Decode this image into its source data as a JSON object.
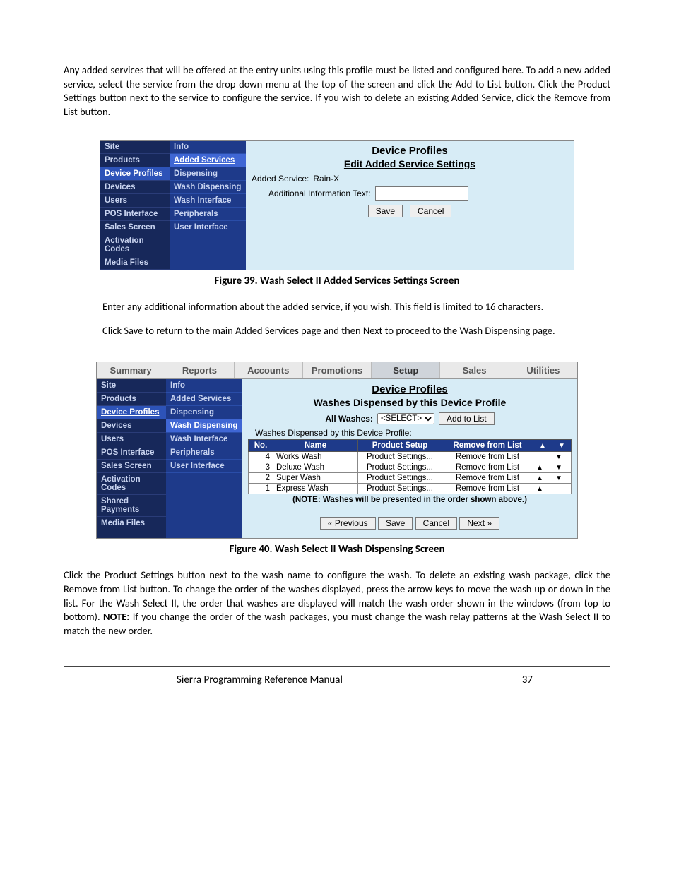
{
  "doc": {
    "para1": "Any added services that will be offered at the entry units using this profile must be listed and configured here. To add a new added service, select the service from the drop down menu at the top of the screen and click the Add to List button. Click the Product Settings button next to the service to configure the service. If you wish to delete an existing Added Service, click the Remove from List button.",
    "figcap1": "Figure 39. Wash Select II Added Services Settings Screen",
    "para2": "Enter any additional information about the added service, if you wish. This field is limited to 16 characters.",
    "para3": "Click Save to return to the main Added Services page and then Next to proceed to the Wash Dispensing page.",
    "figcap2": "Figure 40. Wash Select II Wash Dispensing Screen",
    "para4a": "Click the Product Settings button next to the wash name to configure the wash. To delete an existing wash package, click the Remove from List button. To change the order of the washes displayed, press the arrow keys to move the wash up or down in the list. For the Wash Select II, the order that washes are displayed will match the wash order shown in the windows (from top to bottom). ",
    "note_label": "NOTE:",
    "para4b": " If you change the order of the wash packages, you must change the wash relay patterns at the Wash Select II to match the new order.",
    "footer_title": "Sierra Programming Reference Manual",
    "footer_page": "37"
  },
  "fig39": {
    "nav1": [
      "Site",
      "Products",
      "Device Profiles",
      "Devices",
      "Users",
      "POS Interface",
      "Sales Screen",
      "Activation Codes",
      "Media Files"
    ],
    "nav1_selected": "Device Profiles",
    "nav2": [
      "Info",
      "Added Services",
      "Dispensing",
      "Wash Dispensing",
      "Wash Interface",
      "Peripherals",
      "User Interface"
    ],
    "nav2_selected": "Added Services",
    "h3": "Device Profiles",
    "h4": "Edit Added Service Settings",
    "added_service_label": "Added Service:",
    "added_service_value": "Rain-X",
    "addl_info_label": "Additional Information Text:",
    "addl_info_value": "",
    "save": "Save",
    "cancel": "Cancel"
  },
  "fig40": {
    "tabs": [
      "Summary",
      "Reports",
      "Accounts",
      "Promotions",
      "Setup",
      "Sales",
      "Utilities"
    ],
    "tab_on": "Setup",
    "nav1": [
      "Site",
      "Products",
      "Device Profiles",
      "Devices",
      "Users",
      "POS Interface",
      "Sales Screen",
      "Activation Codes",
      "Shared Payments",
      "Media Files"
    ],
    "nav1_selected": "Device Profiles",
    "nav2": [
      "Info",
      "Added Services",
      "Dispensing",
      "Wash Dispensing",
      "Wash Interface",
      "Peripherals",
      "User Interface"
    ],
    "nav2_selected": "Wash Dispensing",
    "h3": "Device Profiles",
    "h4": "Washes Dispensed by this Device Profile",
    "all_washes_label": "All Washes:",
    "all_washes_select": "<SELECT>",
    "add_to_list": "Add to List",
    "subhead": "Washes Dispensed by this Device Profile:",
    "tbl_headers": [
      "No.",
      "Name",
      "Product Setup",
      "Remove from List",
      "▲",
      "▼"
    ],
    "rows": [
      {
        "no": "4",
        "name": "Works Wash",
        "setup": "Product Settings...",
        "remove": "Remove from List",
        "up": "",
        "down": "▼"
      },
      {
        "no": "3",
        "name": "Deluxe Wash",
        "setup": "Product Settings...",
        "remove": "Remove from List",
        "up": "▲",
        "down": "▼"
      },
      {
        "no": "2",
        "name": "Super Wash",
        "setup": "Product Settings...",
        "remove": "Remove from List",
        "up": "▲",
        "down": "▼"
      },
      {
        "no": "1",
        "name": "Express Wash",
        "setup": "Product Settings...",
        "remove": "Remove from List",
        "up": "▲",
        "down": ""
      }
    ],
    "tbl_note": "(NOTE: Washes will be presented in the order shown above.)",
    "prev": "« Previous",
    "save": "Save",
    "cancel": "Cancel",
    "next": "Next »"
  }
}
